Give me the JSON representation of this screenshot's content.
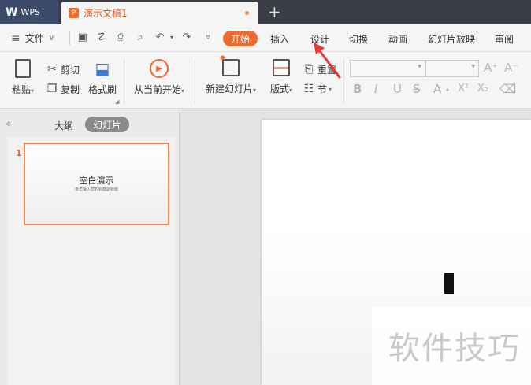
{
  "app": {
    "name": "WPS",
    "logo": "W"
  },
  "tabs": {
    "doc_title": "演示文稿1",
    "doc_icon": "P",
    "new_tab": "+"
  },
  "menubar": {
    "file_label": "文件",
    "tabs": [
      {
        "label": "开始",
        "active": true
      },
      {
        "label": "插入"
      },
      {
        "label": "设计"
      },
      {
        "label": "切换"
      },
      {
        "label": "动画"
      },
      {
        "label": "幻灯片放映"
      },
      {
        "label": "审阅"
      }
    ]
  },
  "ribbon": {
    "paste": "粘贴",
    "cut": "剪切",
    "copy": "复制",
    "format_painter": "格式刷",
    "from_current": "从当前开始",
    "new_slide": "新建幻灯片",
    "layout": "版式",
    "reset": "重置",
    "section": "节",
    "font_glyphs": {
      "bold": "B",
      "italic": "I",
      "underline": "U",
      "strike": "S",
      "color": "A",
      "super": "X²",
      "sub": "X₂",
      "grow": "A⁺",
      "shrink": "A⁻"
    }
  },
  "panel": {
    "outline_tab": "大纲",
    "slides_tab": "幻灯片",
    "collapse": "«",
    "slide_number": "1",
    "thumb_title": "空白演示",
    "thumb_subtitle": "单击输入您的封面副标题"
  },
  "watermark": "软件技巧",
  "colors": {
    "accent": "#ef6a2d",
    "arrow": "#e53935",
    "tabbar": "#3a3d44"
  }
}
